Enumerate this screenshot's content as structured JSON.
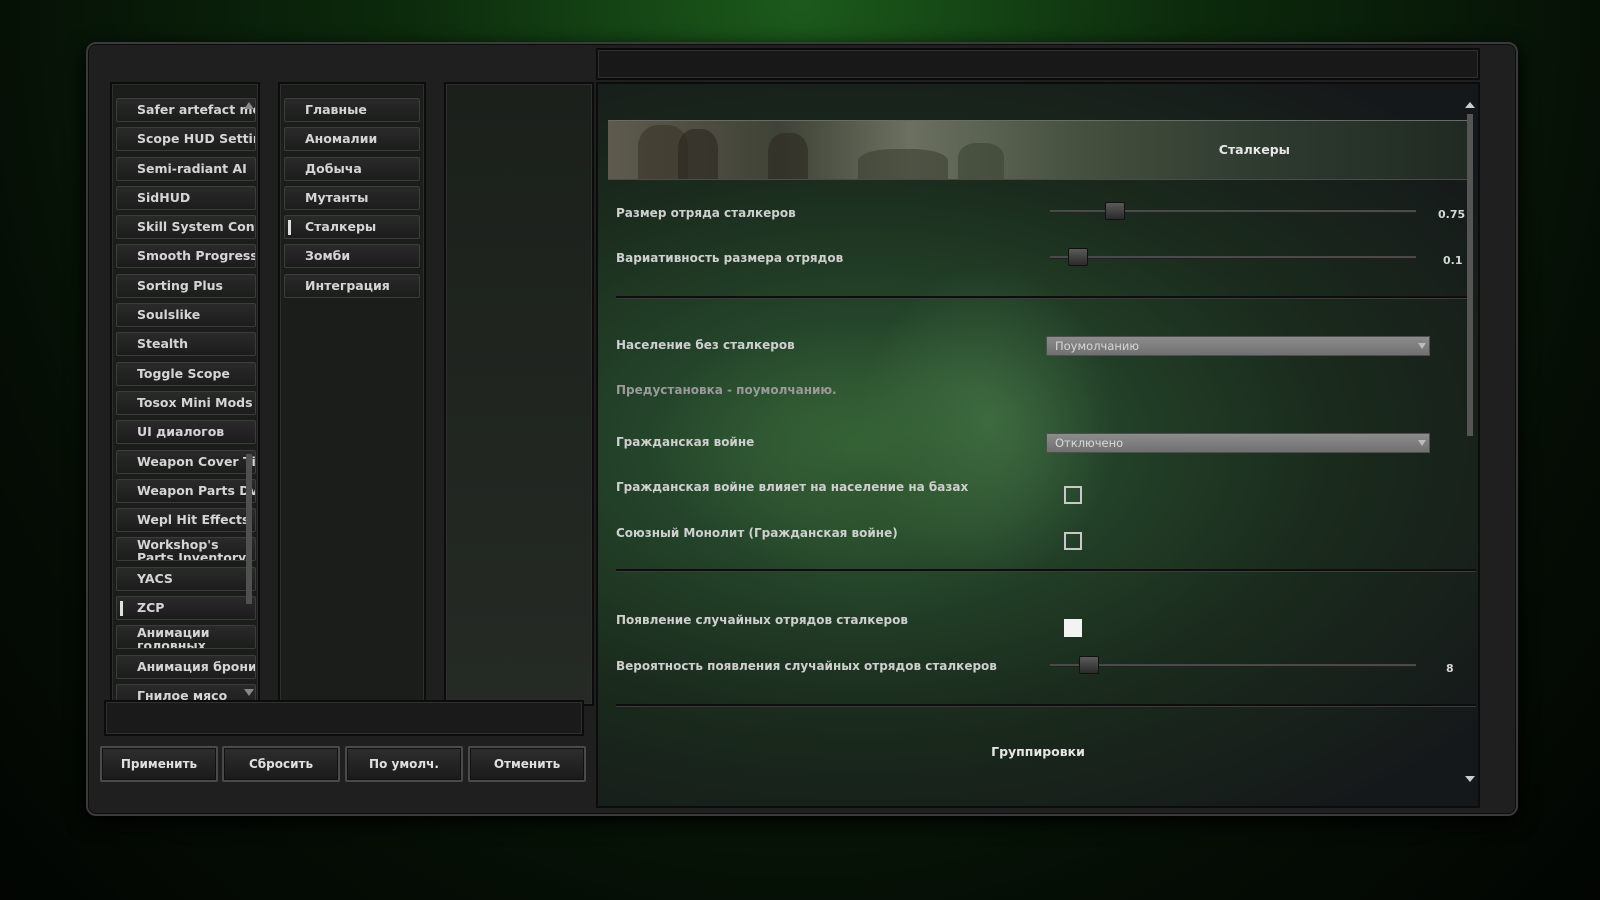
{
  "mods_list": [
    {
      "label": "Safer artefact melting",
      "active": false
    },
    {
      "label": "Scope HUD Settings",
      "active": false
    },
    {
      "label": "Semi-radiant AI",
      "active": false
    },
    {
      "label": "SidHUD",
      "active": false
    },
    {
      "label": "Skill System Config",
      "active": false
    },
    {
      "label": "Smooth Progress",
      "active": false
    },
    {
      "label": "Sorting Plus",
      "active": false
    },
    {
      "label": "Soulslike",
      "active": false
    },
    {
      "label": "Stealth",
      "active": false
    },
    {
      "label": "Toggle Scope",
      "active": false
    },
    {
      "label": "Tosox Mini Mods Repo",
      "active": false
    },
    {
      "label": "UI диалогов",
      "active": false
    },
    {
      "label": "Weapon Cover Tilt",
      "active": false
    },
    {
      "label": "Weapon Parts DvH",
      "active": false
    },
    {
      "label": "Wepl Hit Effects",
      "active": false
    },
    {
      "label": "Workshop's Parts Inventory",
      "active": false
    },
    {
      "label": "YACS",
      "active": false
    },
    {
      "label": "ZCP",
      "active": true
    },
    {
      "label": "Анимации головных уборов",
      "active": false
    },
    {
      "label": "Анимация брони",
      "active": false
    },
    {
      "label": "Гнилое мясо",
      "active": false
    }
  ],
  "categories": [
    {
      "label": "Главные",
      "active": false
    },
    {
      "label": "Аномалии",
      "active": false
    },
    {
      "label": "Добыча",
      "active": false
    },
    {
      "label": "Мутанты",
      "active": false
    },
    {
      "label": "Сталкеры",
      "active": true
    },
    {
      "label": "Зомби",
      "active": false
    },
    {
      "label": "Интеграция",
      "active": false
    }
  ],
  "buttons": {
    "apply": "Применить",
    "reset": "Сбросить",
    "default": "По умолч.",
    "cancel": "Отменить"
  },
  "settings": {
    "banner_title": "Сталкеры",
    "squad_size": {
      "label": "Размер отряда сталкеров",
      "value": "0.75",
      "level": 0.15
    },
    "squad_variance": {
      "label": "Вариативность размера отрядов",
      "value": "0.1",
      "level": 0.05
    },
    "population_without_stalkers": {
      "label": "Население без сталкеров",
      "selected": "Поумолчанию"
    },
    "preset_note": "Предустановка - поумолчанию.",
    "civil_war": {
      "label": "Гражданская войне",
      "selected": "Отключено"
    },
    "civil_war_affects_bases": {
      "label": "Гражданская войне влияет на население на базах",
      "checked": false
    },
    "allied_monolith": {
      "label": "Союзный Монолит (Гражданская войне)",
      "checked": false
    },
    "random_squads": {
      "label": "Появление случайных отрядов сталкеров",
      "checked": true
    },
    "random_squads_chance": {
      "label": "Вероятность появления случайных отрядов сталкеров",
      "value": "8",
      "level": 0.08
    },
    "next_section_title": "Группировки"
  }
}
